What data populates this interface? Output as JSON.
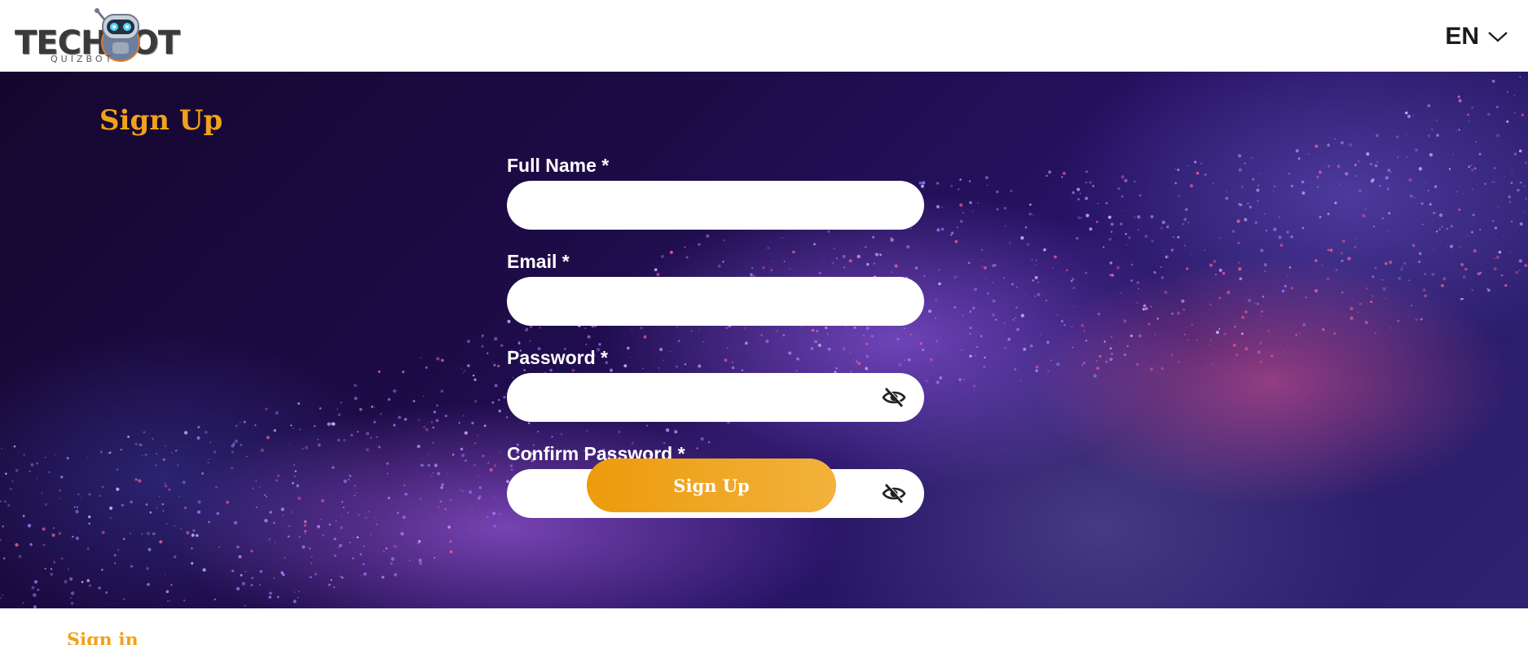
{
  "header": {
    "logo_text": "TECHBOT",
    "logo_subtext": "QUIZBOT",
    "language": "EN"
  },
  "page": {
    "title": "Sign Up"
  },
  "form": {
    "full_name_label": "Full Name *",
    "email_label": "Email *",
    "password_label": "Password *",
    "confirm_password_label": "Confirm Password *",
    "submit_label": "Sign Up"
  },
  "footer": {
    "sign_in_link": "Sign in"
  },
  "colors": {
    "accent": "#f0a21a",
    "button_start": "#ec9b0b",
    "button_end": "#f2b23c",
    "hero_dark": "#14072e",
    "particle_purple": "#b27dff",
    "particle_pink": "#e85a96"
  },
  "icons": {
    "language_dropdown": "chevron-down-icon",
    "password_visibility": "eye-off-icon"
  }
}
